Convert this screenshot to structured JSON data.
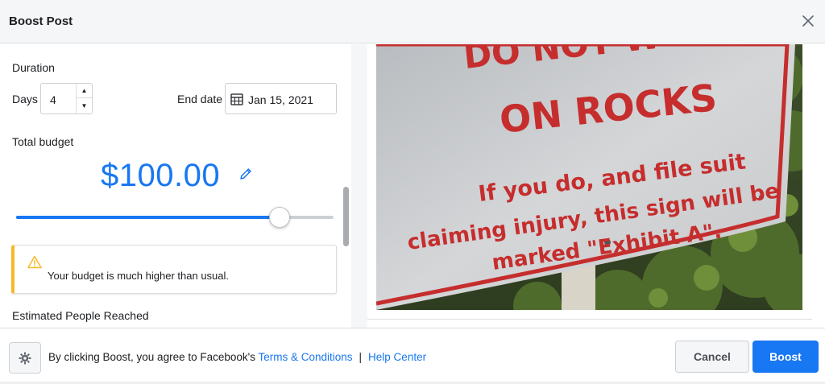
{
  "header": {
    "title": "Boost Post",
    "close_icon": "close-icon"
  },
  "settings": {
    "duration_label": "Duration",
    "days_label": "Days",
    "days_value": "4",
    "end_date_label": "End date",
    "end_date_value": "Jan 15, 2021",
    "total_budget_label": "Total budget",
    "budget_amount": "$100.00",
    "budget_slider_fraction": 0.83,
    "warning_text": "Your budget is much higher than usual.",
    "estimated_label": "Estimated People Reached"
  },
  "preview": {
    "sign_lines": [
      "DO NOT W",
      "ON ROCKS",
      "If you do, and file suit",
      "claiming injury, this sign will be",
      "marked \"Exhibit A\"."
    ]
  },
  "footer": {
    "legal_prefix": "By clicking Boost, you agree to Facebook's",
    "terms_link": "Terms & Conditions",
    "separator": "|",
    "help_link": "Help Center",
    "cancel_label": "Cancel",
    "boost_label": "Boost"
  },
  "colors": {
    "accent": "#1877f2",
    "warning": "#f7b928",
    "sign_red": "#c62d2d"
  }
}
